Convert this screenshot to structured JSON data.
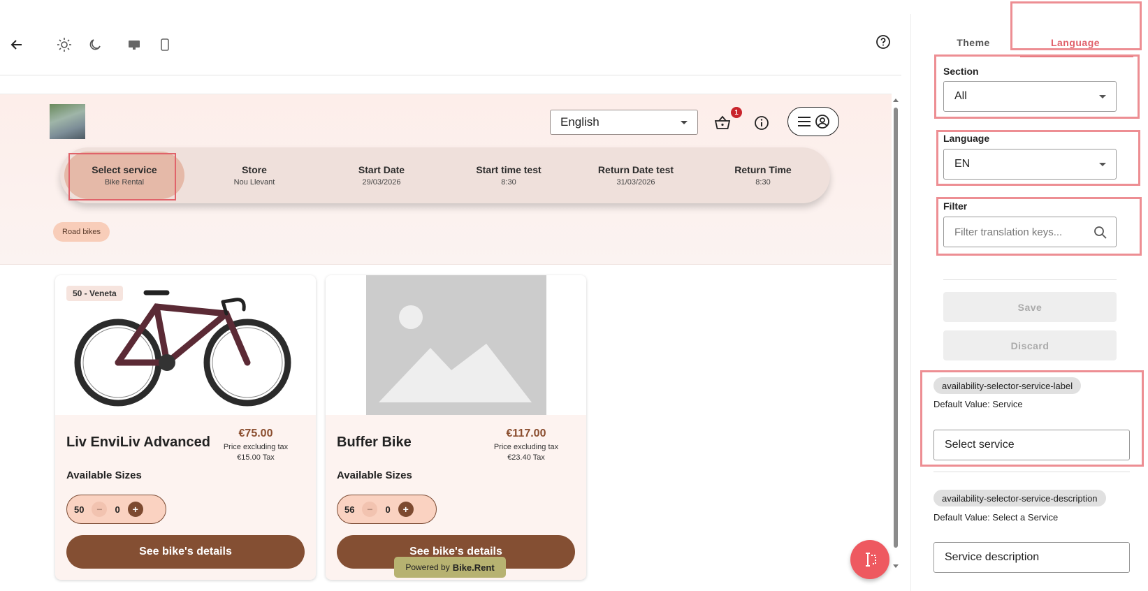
{
  "toolbar": {
    "back_icon": "arrow-left-icon",
    "light_icon": "sun-icon",
    "dark_icon": "moon-icon",
    "desktop_icon": "monitor-icon",
    "mobile_icon": "phone-icon",
    "help_icon": "help-circle-icon"
  },
  "header": {
    "language_value": "English",
    "cart_count": "1"
  },
  "stepper": {
    "steps": [
      {
        "title": "Select service",
        "sub": "Bike Rental"
      },
      {
        "title": "Store",
        "sub": "Nou Llevant"
      },
      {
        "title": "Start Date",
        "sub": "29/03/2026"
      },
      {
        "title": "Start time test",
        "sub": "8:30"
      },
      {
        "title": "Return Date test",
        "sub": "31/03/2026"
      },
      {
        "title": "Return Time",
        "sub": "8:30"
      }
    ]
  },
  "category_chip": "Road bikes",
  "cards": [
    {
      "size_label": "50 - Veneta",
      "name": "Liv EnviLiv Advanced",
      "price": "€75.00",
      "price_note": "Price excluding tax",
      "tax": "€15.00 Tax",
      "available_sizes": "Available Sizes",
      "size": "50",
      "qty": "0",
      "minus": "−",
      "plus": "+",
      "details": "See bike's details"
    },
    {
      "size_label": "",
      "name": "Buffer Bike",
      "price": "€117.00",
      "price_note": "Price excluding tax",
      "tax": "€23.40 Tax",
      "available_sizes": "Available Sizes",
      "size": "56",
      "qty": "0",
      "minus": "−",
      "plus": "+",
      "details": "See bike's details"
    }
  ],
  "powered": {
    "prefix": "Powered by",
    "brand": "Bike.Rent"
  },
  "panel": {
    "tabs": {
      "theme": "Theme",
      "language": "Language"
    },
    "section": {
      "label": "Section",
      "value": "All"
    },
    "language": {
      "label": "Language",
      "value": "EN"
    },
    "filter": {
      "label": "Filter",
      "placeholder": "Filter translation keys..."
    },
    "save": "Save",
    "discard": "Discard",
    "entries": [
      {
        "key": "availability-selector-service-label",
        "default": "Default Value: Service",
        "value": "Select service"
      },
      {
        "key": "availability-selector-service-description",
        "default": "Default Value: Select a Service",
        "value": "Service description"
      }
    ]
  },
  "colors": {
    "accent": "#e0606a",
    "brown": "#844f33",
    "highlight": "#ed8e93"
  }
}
